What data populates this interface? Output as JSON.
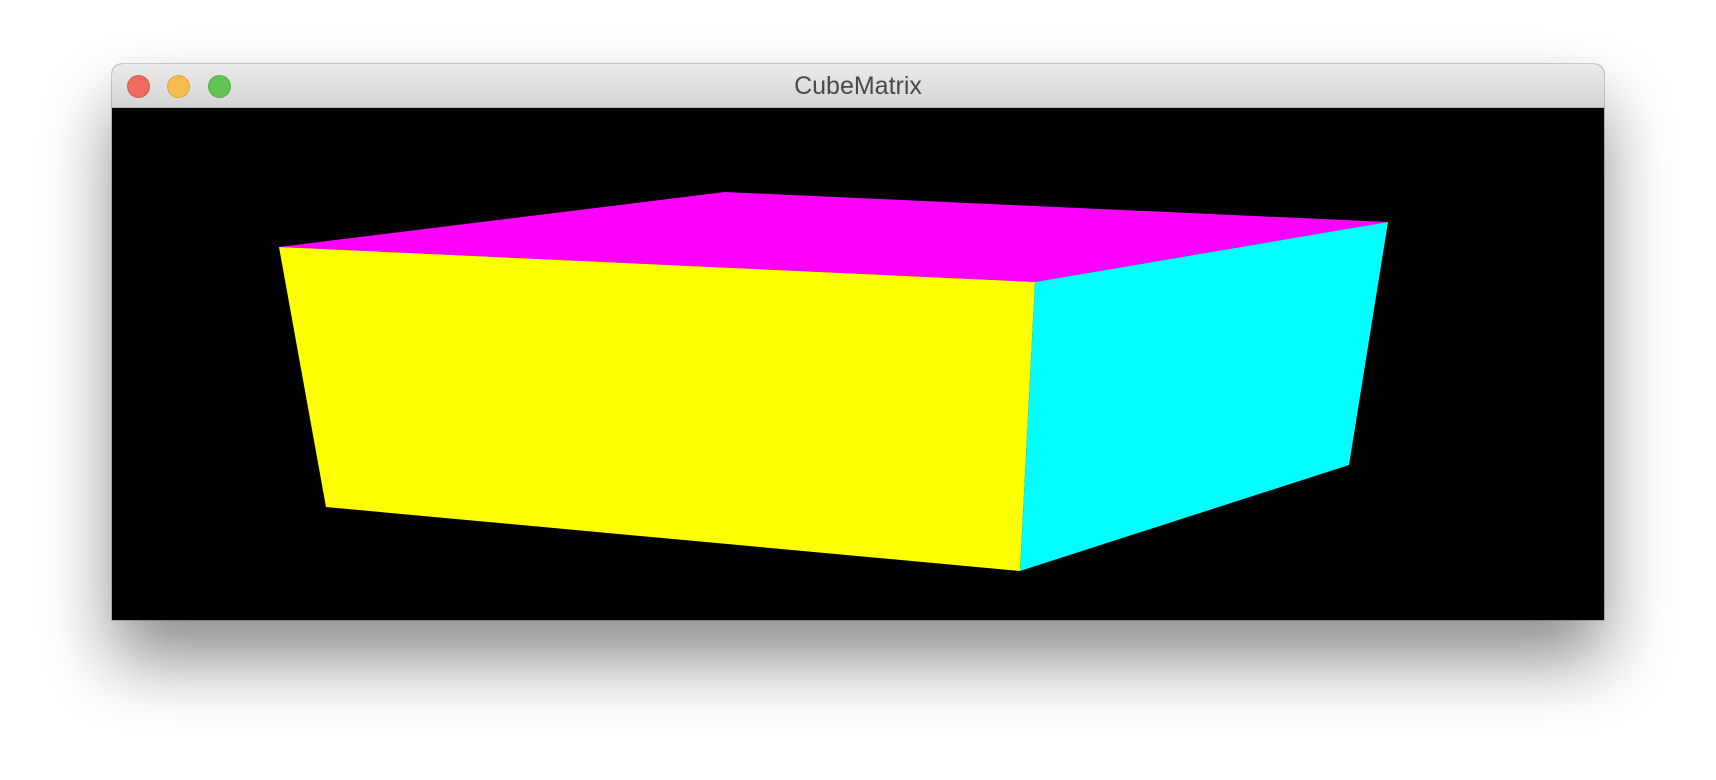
{
  "window": {
    "title": "CubeMatrix",
    "controls": {
      "close_color": "#ee6a5f",
      "minimize_color": "#f5bd4f",
      "zoom_color": "#61c454"
    }
  },
  "scene": {
    "background_color": "#000000",
    "object": "cube",
    "faces": [
      {
        "name": "top",
        "color": "#ff00ff"
      },
      {
        "name": "front",
        "color": "#ffff00"
      },
      {
        "name": "side",
        "color": "#00ffff"
      }
    ]
  }
}
